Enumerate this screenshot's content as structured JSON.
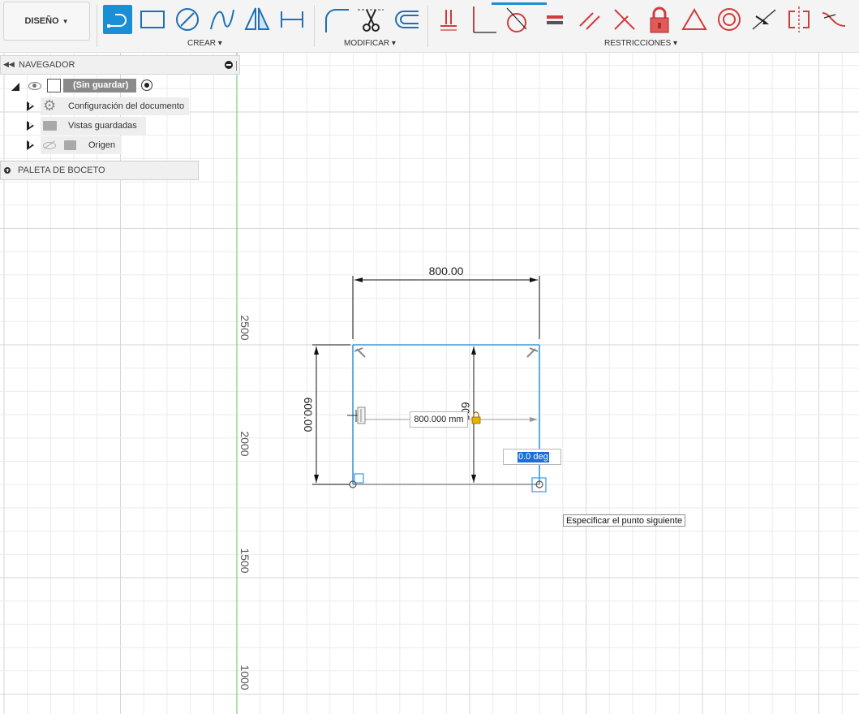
{
  "toolbar": {
    "design_label": "DISEÑO",
    "groups": {
      "create": "CREAR",
      "modify": "MODIFICAR",
      "constraints": "RESTRICCIONES"
    },
    "icons": {
      "create": [
        "line-icon",
        "rectangle-icon",
        "circle-icon",
        "spline-icon",
        "mirror-icon",
        "dimension-icon"
      ],
      "modify": [
        "fillet-icon",
        "trim-icon",
        "offset-icon"
      ],
      "constraints": [
        "coincident-icon",
        "perpendicular-corner-icon",
        "tangent-icon",
        "equal-icon",
        "parallel-icon",
        "perpendicular-icon",
        "fix-lock-icon",
        "midpoint-icon",
        "concentric-icon",
        "collinear-icon",
        "symmetry-icon",
        "curvature-icon"
      ]
    },
    "accent_color": "#1a8fd6",
    "constraint_color": "#d13c3c"
  },
  "browser": {
    "navigator_label": "NAVEGADOR",
    "root_label": "(Sin guardar)",
    "items": [
      {
        "label": "Configuración del documento",
        "icon": "gear-icon"
      },
      {
        "label": "Vistas guardadas",
        "icon": "folder-icon"
      },
      {
        "label": "Origen",
        "icon": "folder-icon"
      }
    ],
    "palette_label": "PALETA DE BOCETO"
  },
  "ruler": {
    "labels": [
      "2500",
      "2000",
      "1500",
      "1000"
    ]
  },
  "sketch": {
    "dimension_width": "800.00",
    "dimension_height_left": "600.00",
    "dimension_height_inner": "600",
    "length_input": "800.000 mm",
    "angle_input": "0.0 deg",
    "sketch_color": "#3a9ad9"
  },
  "tooltip": "Especificar el punto siguiente"
}
